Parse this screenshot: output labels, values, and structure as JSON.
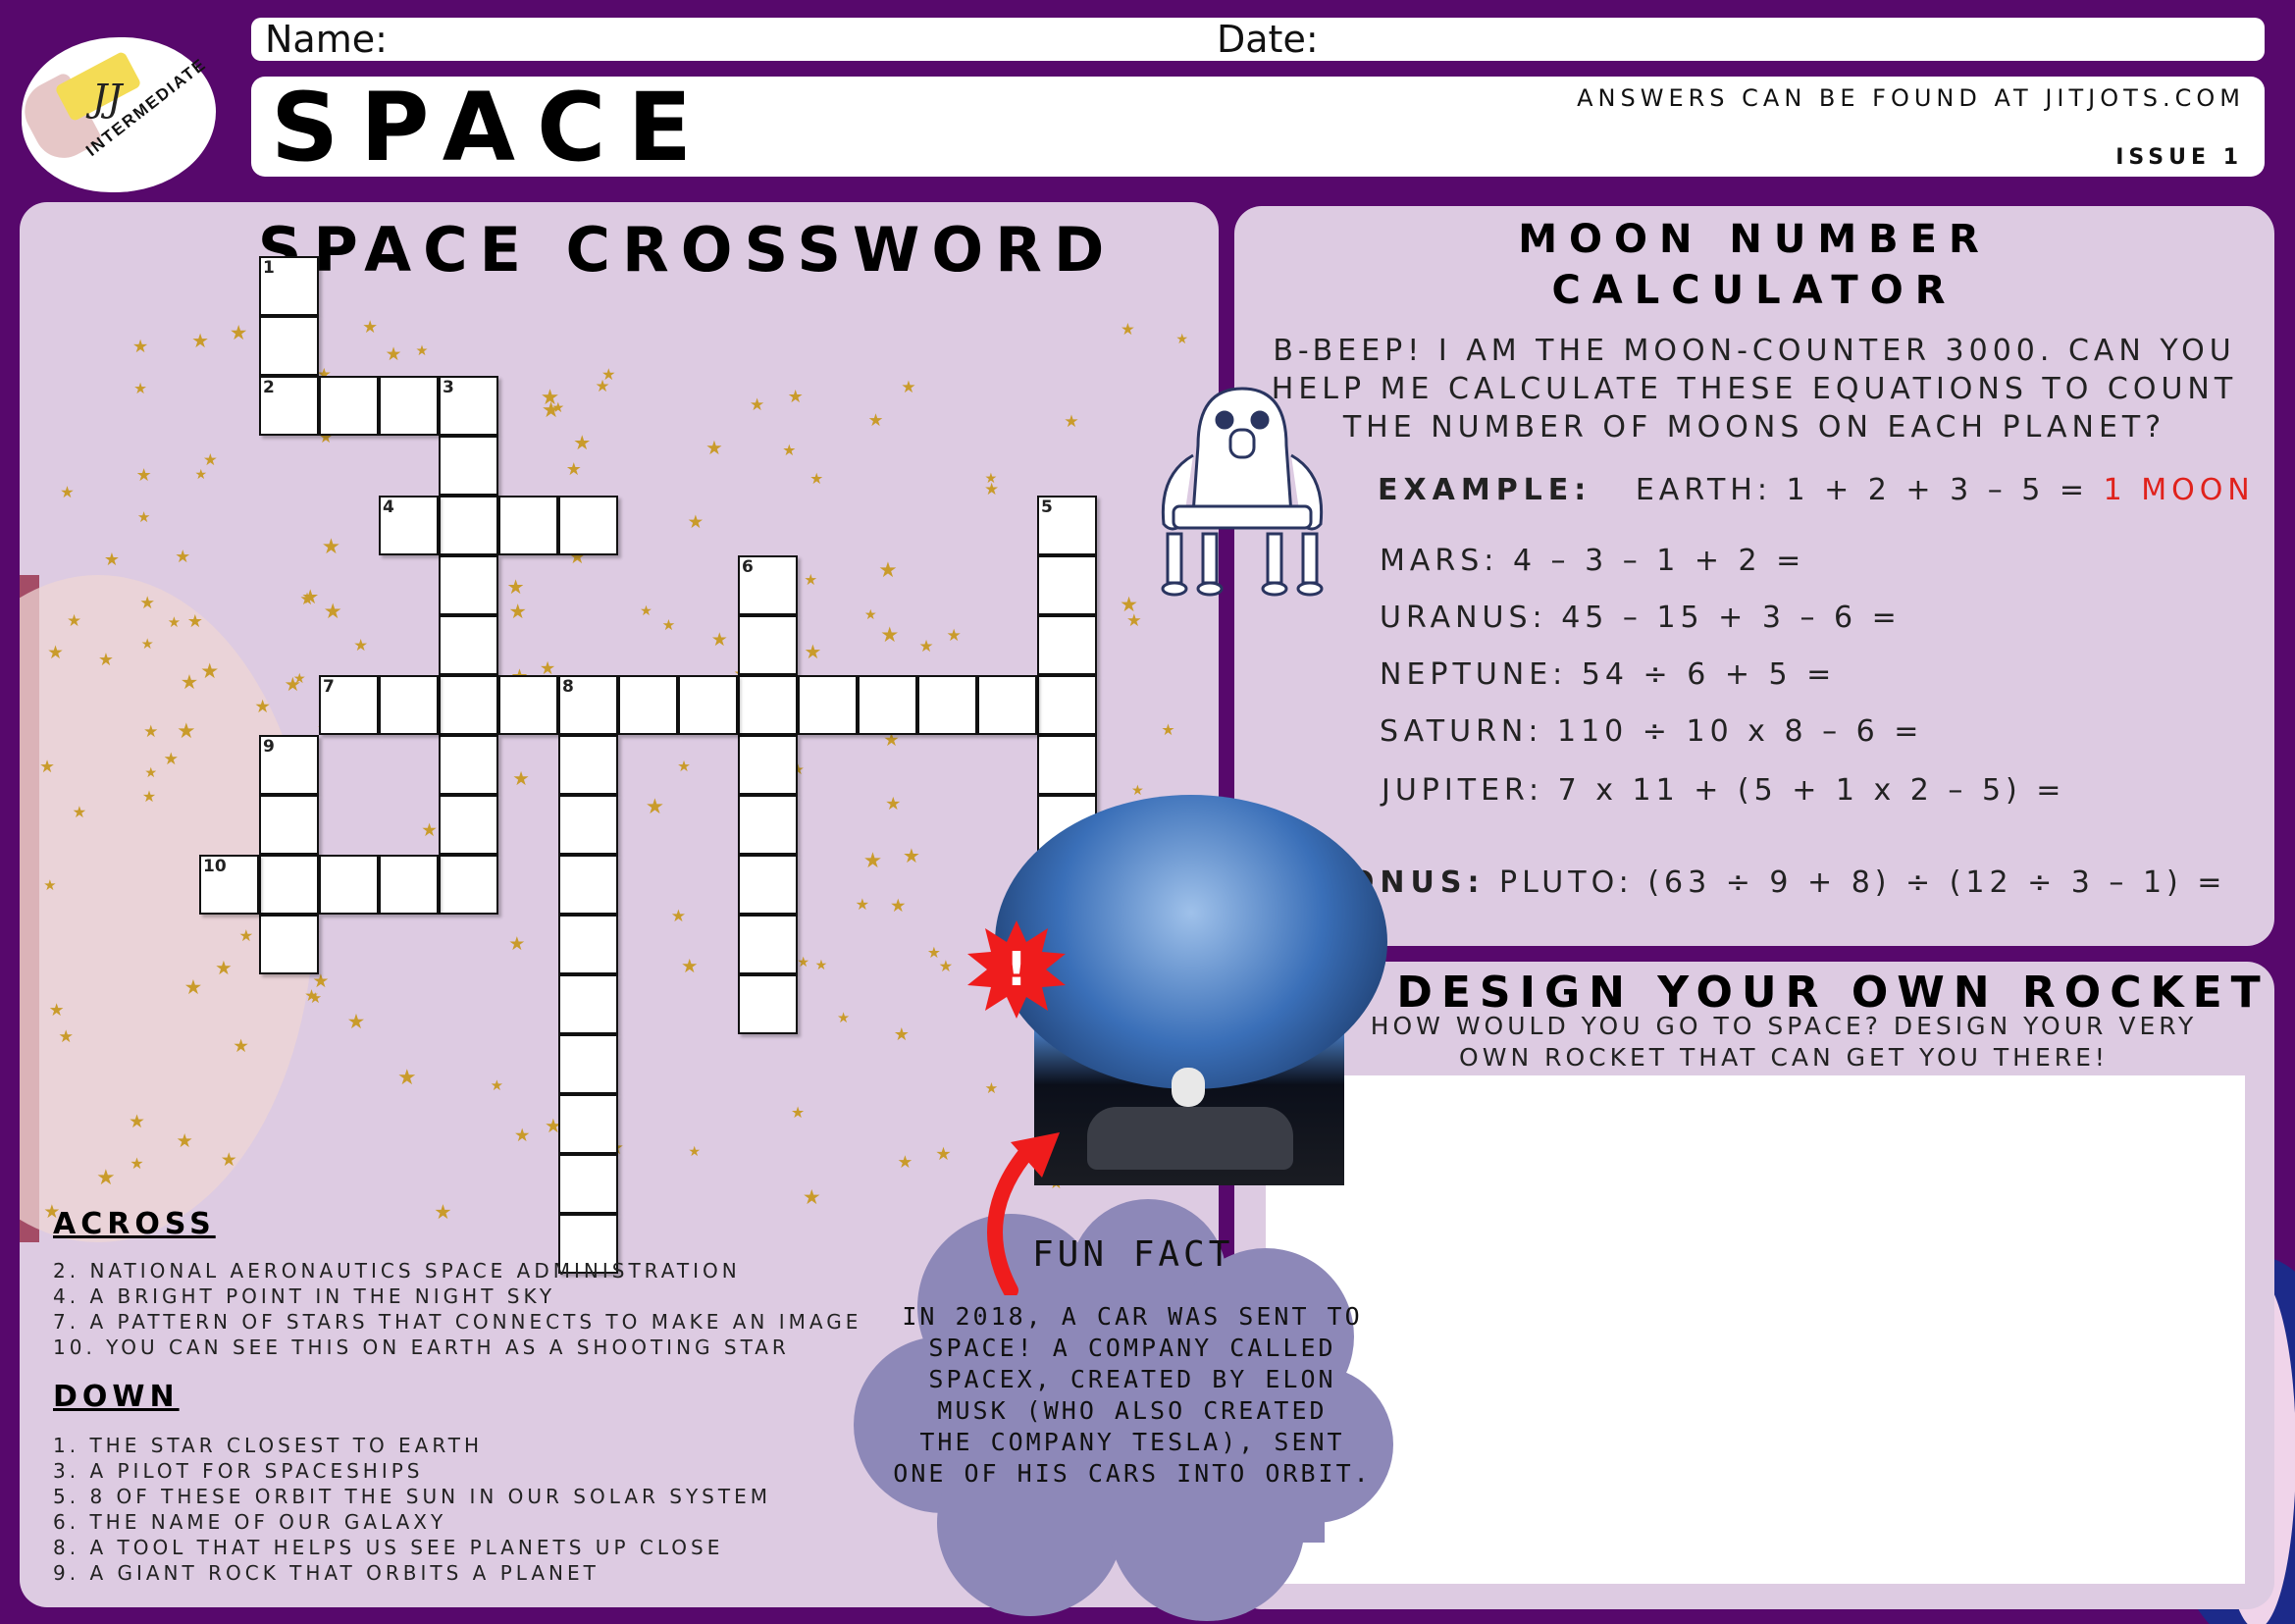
{
  "header": {
    "logo_text": "JJ",
    "level": "INTERMEDIATE",
    "name_label": "Name:",
    "date_label": "Date:",
    "title": "SPACE",
    "answers": "ANSWERS CAN BE FOUND AT JITJOTS.COM",
    "issue": "ISSUE 1"
  },
  "crossword": {
    "title": "SPACE CROSSWORD",
    "across_heading": "ACROSS",
    "across": [
      "2. NATIONAL AERONAUTICS SPACE ADMINISTRATION",
      "4. A BRIGHT POINT IN THE NIGHT SKY",
      "7. A PATTERN OF STARS THAT CONNECTS TO MAKE AN IMAGE",
      "10. YOU CAN SEE THIS ON EARTH AS A SHOOTING STAR"
    ],
    "down_heading": "DOWN",
    "down": [
      "1. THE STAR CLOSEST TO EARTH",
      "3. A PILOT FOR SPACESHIPS",
      "5. 8 OF THESE ORBIT THE SUN IN OUR SOLAR SYSTEM",
      "6. THE NAME OF OUR GALAXY",
      "8. A TOOL THAT HELPS US SEE PLANETS UP CLOSE",
      "9. A GIANT ROCK THAT ORBITS A PLANET"
    ],
    "numbers": [
      "1",
      "2",
      "3",
      "4",
      "5",
      "6",
      "7",
      "8",
      "9",
      "10"
    ]
  },
  "moon": {
    "title_line1": "MOON NUMBER",
    "title_line2": "CALCULATOR",
    "intro_line1": "B-BEEP! I AM THE MOON-COUNTER 3000. CAN YOU",
    "intro_line2": "HELP ME CALCULATE THESE EQUATIONS TO COUNT",
    "intro_line3": "THE NUMBER OF MOONS ON EACH PLANET?",
    "example_label": "EXAMPLE:",
    "example_eq": "EARTH: 1 + 2 + 3 – 5 =",
    "example_answer": "1 MOON",
    "equations": [
      "MARS: 4 – 3 – 1 + 2 =",
      "URANUS: 45 – 15 + 3 – 6 =",
      "NEPTUNE: 54 ÷ 6 + 5 =",
      "SATURN: 110 ÷ 10 x 8 – 6 =",
      "JUPITER: 7 x 11 + (5 + 1 x 2 – 5) ="
    ],
    "bonus_label": "BONUS:",
    "bonus_eq": "PLUTO: (63 ÷ 9 + 8) ÷ (12 ÷ 3 – 1) ="
  },
  "rocket": {
    "title": "DESIGN YOUR OWN ROCKET",
    "sub_line1": "HOW WOULD YOU GO TO SPACE? DESIGN YOUR VERY",
    "sub_line2": "OWN ROCKET THAT CAN GET YOU THERE!"
  },
  "funfact": {
    "heading": "FUN FACT",
    "lines": [
      "IN 2018, A CAR WAS SENT TO",
      "SPACE! A COMPANY CALLED",
      "SPACEX, CREATED BY ELON",
      "MUSK (WHO ALSO CREATED",
      "THE COMPANY TESLA), SENT",
      "ONE OF HIS CARS INTO ORBIT."
    ],
    "alert_mark": "!"
  },
  "colors": {
    "background": "#57086c",
    "panel": "#ddcbe2",
    "star": "#c99b2b",
    "answer_red": "#e0221c",
    "cloud": "#8d88b8"
  },
  "icons": [
    "robot-icon",
    "alert-burst-icon",
    "arrow-icon",
    "star-icon"
  ]
}
